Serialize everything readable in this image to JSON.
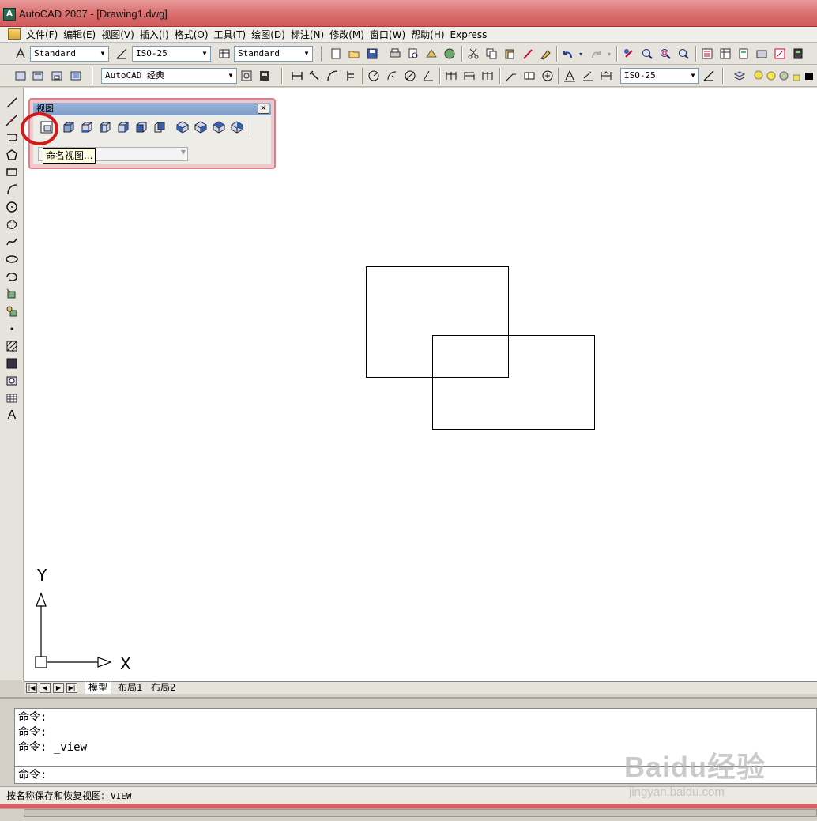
{
  "window": {
    "title": "AutoCAD 2007 - [Drawing1.dwg]"
  },
  "menu": {
    "items": [
      "文件(F)",
      "编辑(E)",
      "视图(V)",
      "插入(I)",
      "格式(O)",
      "工具(T)",
      "绘图(D)",
      "标注(N)",
      "修改(M)",
      "窗口(W)",
      "帮助(H)",
      "Express"
    ]
  },
  "toolbar1": {
    "text_style": "Standard",
    "dim_style": "ISO-25",
    "table_style": "Standard"
  },
  "toolbar2": {
    "workspace": "AutoCAD 经典",
    "dim_style": "ISO-25"
  },
  "view_toolbar": {
    "title": "视图",
    "close_label": "✕",
    "tooltip": "命名视图..."
  },
  "ucs": {
    "x_label": "X",
    "y_label": "Y"
  },
  "tabs": {
    "items": [
      "模型",
      "布局1",
      "布局2"
    ]
  },
  "command_line": {
    "history": [
      "命令:",
      "命令:",
      "命令: _view"
    ],
    "prompt": "命令:"
  },
  "status": {
    "description": "按名称保存和恢复视图:",
    "command": "VIEW"
  },
  "watermark": {
    "brand": "Baidu经验",
    "site": "jingyan.baidu.com"
  },
  "colors": {
    "title_bar": "#d86a6a",
    "highlight": "#d11a1a",
    "tooltip_bg": "#ffffe1"
  }
}
